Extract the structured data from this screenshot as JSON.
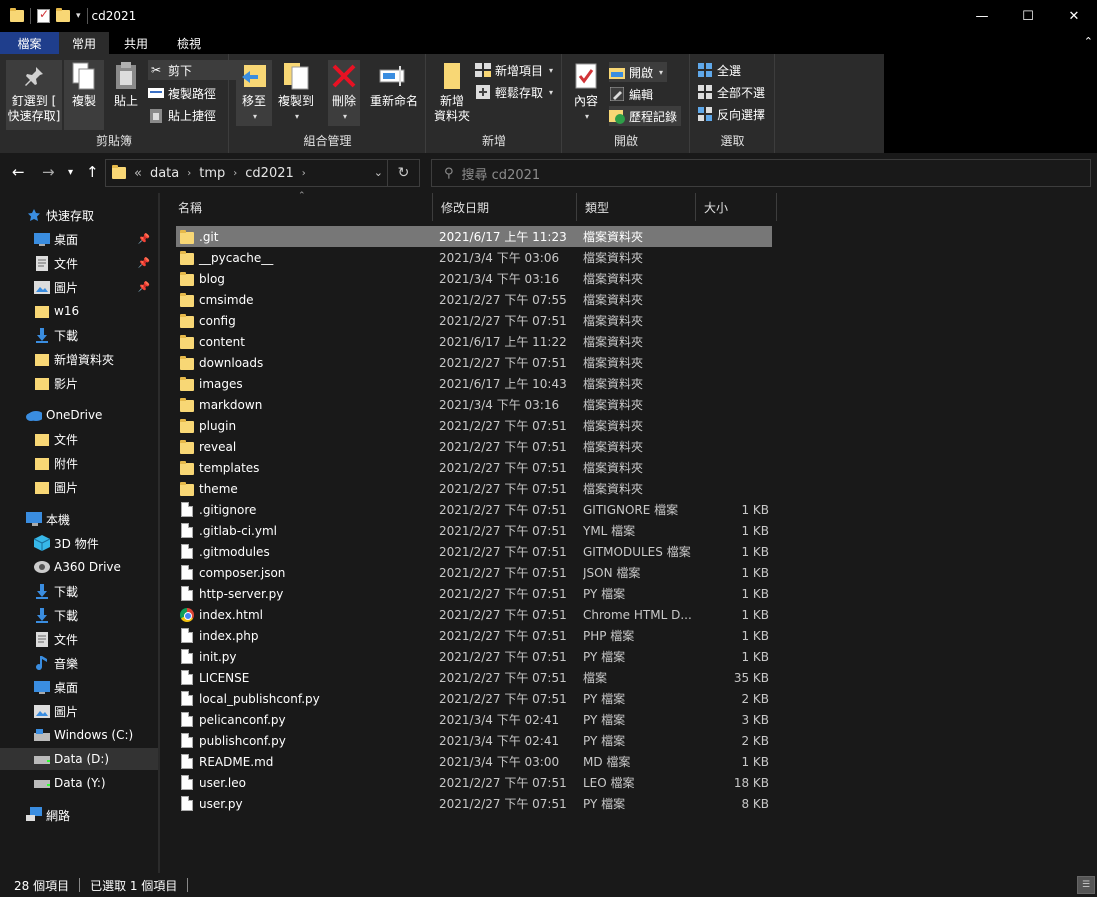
{
  "window": {
    "title": "cd2021"
  },
  "ribbon": {
    "tabs": [
      {
        "label": "檔案"
      },
      {
        "label": "常用"
      },
      {
        "label": "共用"
      },
      {
        "label": "檢視"
      }
    ],
    "clipboard": {
      "group": "剪貼簿",
      "pin_quick": "釘選到 [\n快速存取]",
      "copy": "複製",
      "paste": "貼上",
      "cut": "剪下",
      "copy_path": "複製路徑",
      "paste_shortcut": "貼上捷徑"
    },
    "organize": {
      "group": "組合管理",
      "move_to": "移至",
      "copy_to": "複製到",
      "delete": "刪除",
      "rename": "重新命名"
    },
    "new": {
      "group": "新增",
      "new_folder": "新增\n資料夾",
      "new_item": "新增項目",
      "easy_access": "輕鬆存取"
    },
    "open": {
      "group": "開啟",
      "properties": "內容",
      "open": "開啟",
      "edit": "編輯",
      "history": "歷程記錄"
    },
    "select": {
      "group": "選取",
      "select_all": "全選",
      "select_none": "全部不選",
      "invert": "反向選擇"
    }
  },
  "address": {
    "overflow": "«",
    "crumbs": [
      "data",
      "tmp",
      "cd2021"
    ],
    "search_placeholder": "搜尋 cd2021"
  },
  "nav": {
    "items": [
      {
        "label": "快速存取",
        "icon": "star-icon",
        "level": 0,
        "pinned": false
      },
      {
        "label": "桌面",
        "icon": "desktop-icon",
        "level": 1,
        "pinned": true
      },
      {
        "label": "文件",
        "icon": "documents-icon",
        "level": 1,
        "pinned": true
      },
      {
        "label": "圖片",
        "icon": "pictures-icon",
        "level": 1,
        "pinned": true
      },
      {
        "label": "w16",
        "icon": "folder-icon",
        "level": 1,
        "pinned": false
      },
      {
        "label": "下載",
        "icon": "download-icon",
        "level": 1,
        "pinned": false
      },
      {
        "label": "新增資料夾",
        "icon": "folder-icon",
        "level": 1,
        "pinned": false
      },
      {
        "label": "影片",
        "icon": "folder-icon",
        "level": 1,
        "pinned": false
      },
      {
        "label": "OneDrive",
        "icon": "cloud-icon",
        "level": 0,
        "pinned": false
      },
      {
        "label": "文件",
        "icon": "folder-icon",
        "level": 1,
        "pinned": false
      },
      {
        "label": "附件",
        "icon": "folder-icon",
        "level": 1,
        "pinned": false
      },
      {
        "label": "圖片",
        "icon": "folder-icon",
        "level": 1,
        "pinned": false
      },
      {
        "label": "本機",
        "icon": "computer-icon",
        "level": 0,
        "pinned": false
      },
      {
        "label": "3D 物件",
        "icon": "3d-objects-icon",
        "level": 1,
        "pinned": false
      },
      {
        "label": "A360 Drive",
        "icon": "a360-drive-icon",
        "level": 1,
        "pinned": false
      },
      {
        "label": "下載",
        "icon": "download-icon",
        "level": 1,
        "pinned": false
      },
      {
        "label": "下載",
        "icon": "download-icon",
        "level": 1,
        "pinned": false
      },
      {
        "label": "文件",
        "icon": "documents-icon",
        "level": 1,
        "pinned": false
      },
      {
        "label": "音樂",
        "icon": "music-icon",
        "level": 1,
        "pinned": false
      },
      {
        "label": "桌面",
        "icon": "desktop-icon",
        "level": 1,
        "pinned": false
      },
      {
        "label": "圖片",
        "icon": "pictures-icon",
        "level": 1,
        "pinned": false
      },
      {
        "label": "Windows (C:)",
        "icon": "windows-drive-icon",
        "level": 1,
        "pinned": false
      },
      {
        "label": "Data (D:)",
        "icon": "drive-icon",
        "level": 1,
        "pinned": false,
        "selected": true
      },
      {
        "label": "Data (Y:)",
        "icon": "drive-icon",
        "level": 1,
        "pinned": false
      },
      {
        "label": "網路",
        "icon": "network-icon",
        "level": 0,
        "pinned": false
      }
    ]
  },
  "columns": {
    "name": "名稱",
    "date": "修改日期",
    "type": "類型",
    "size": "大小"
  },
  "files": [
    {
      "name": ".git",
      "date": "2021/6/17 上午 11:23",
      "type": "檔案資料夾",
      "size": "",
      "icon": "folder",
      "selected": true
    },
    {
      "name": "__pycache__",
      "date": "2021/3/4 下午 03:06",
      "type": "檔案資料夾",
      "size": "",
      "icon": "folder"
    },
    {
      "name": "blog",
      "date": "2021/3/4 下午 03:16",
      "type": "檔案資料夾",
      "size": "",
      "icon": "folder"
    },
    {
      "name": "cmsimde",
      "date": "2021/2/27 下午 07:55",
      "type": "檔案資料夾",
      "size": "",
      "icon": "folder"
    },
    {
      "name": "config",
      "date": "2021/2/27 下午 07:51",
      "type": "檔案資料夾",
      "size": "",
      "icon": "folder"
    },
    {
      "name": "content",
      "date": "2021/6/17 上午 11:22",
      "type": "檔案資料夾",
      "size": "",
      "icon": "folder"
    },
    {
      "name": "downloads",
      "date": "2021/2/27 下午 07:51",
      "type": "檔案資料夾",
      "size": "",
      "icon": "folder"
    },
    {
      "name": "images",
      "date": "2021/6/17 上午 10:43",
      "type": "檔案資料夾",
      "size": "",
      "icon": "folder"
    },
    {
      "name": "markdown",
      "date": "2021/3/4 下午 03:16",
      "type": "檔案資料夾",
      "size": "",
      "icon": "folder"
    },
    {
      "name": "plugin",
      "date": "2021/2/27 下午 07:51",
      "type": "檔案資料夾",
      "size": "",
      "icon": "folder"
    },
    {
      "name": "reveal",
      "date": "2021/2/27 下午 07:51",
      "type": "檔案資料夾",
      "size": "",
      "icon": "folder"
    },
    {
      "name": "templates",
      "date": "2021/2/27 下午 07:51",
      "type": "檔案資料夾",
      "size": "",
      "icon": "folder"
    },
    {
      "name": "theme",
      "date": "2021/2/27 下午 07:51",
      "type": "檔案資料夾",
      "size": "",
      "icon": "folder"
    },
    {
      "name": ".gitignore",
      "date": "2021/2/27 下午 07:51",
      "type": "GITIGNORE 檔案",
      "size": "1 KB",
      "icon": "doc"
    },
    {
      "name": ".gitlab-ci.yml",
      "date": "2021/2/27 下午 07:51",
      "type": "YML 檔案",
      "size": "1 KB",
      "icon": "doc"
    },
    {
      "name": ".gitmodules",
      "date": "2021/2/27 下午 07:51",
      "type": "GITMODULES 檔案",
      "size": "1 KB",
      "icon": "doc"
    },
    {
      "name": "composer.json",
      "date": "2021/2/27 下午 07:51",
      "type": "JSON 檔案",
      "size": "1 KB",
      "icon": "doc"
    },
    {
      "name": "http-server.py",
      "date": "2021/2/27 下午 07:51",
      "type": "PY 檔案",
      "size": "1 KB",
      "icon": "doc"
    },
    {
      "name": "index.html",
      "date": "2021/2/27 下午 07:51",
      "type": "Chrome HTML D...",
      "size": "1 KB",
      "icon": "chrome"
    },
    {
      "name": "index.php",
      "date": "2021/2/27 下午 07:51",
      "type": "PHP 檔案",
      "size": "1 KB",
      "icon": "doc"
    },
    {
      "name": "init.py",
      "date": "2021/2/27 下午 07:51",
      "type": "PY 檔案",
      "size": "1 KB",
      "icon": "doc"
    },
    {
      "name": "LICENSE",
      "date": "2021/2/27 下午 07:51",
      "type": "檔案",
      "size": "35 KB",
      "icon": "doc"
    },
    {
      "name": "local_publishconf.py",
      "date": "2021/2/27 下午 07:51",
      "type": "PY 檔案",
      "size": "2 KB",
      "icon": "doc"
    },
    {
      "name": "pelicanconf.py",
      "date": "2021/3/4 下午 02:41",
      "type": "PY 檔案",
      "size": "3 KB",
      "icon": "doc"
    },
    {
      "name": "publishconf.py",
      "date": "2021/3/4 下午 02:41",
      "type": "PY 檔案",
      "size": "2 KB",
      "icon": "doc"
    },
    {
      "name": "README.md",
      "date": "2021/3/4 下午 03:00",
      "type": "MD 檔案",
      "size": "1 KB",
      "icon": "doc"
    },
    {
      "name": "user.leo",
      "date": "2021/2/27 下午 07:51",
      "type": "LEO 檔案",
      "size": "18 KB",
      "icon": "doc"
    },
    {
      "name": "user.py",
      "date": "2021/2/27 下午 07:51",
      "type": "PY 檔案",
      "size": "8 KB",
      "icon": "doc"
    }
  ],
  "status": {
    "count": "28 個項目",
    "selected": "已選取 1 個項目"
  },
  "colors": {
    "file_tab": "#1f3e8c",
    "folder": "#f8d775",
    "selection": "#777777"
  }
}
